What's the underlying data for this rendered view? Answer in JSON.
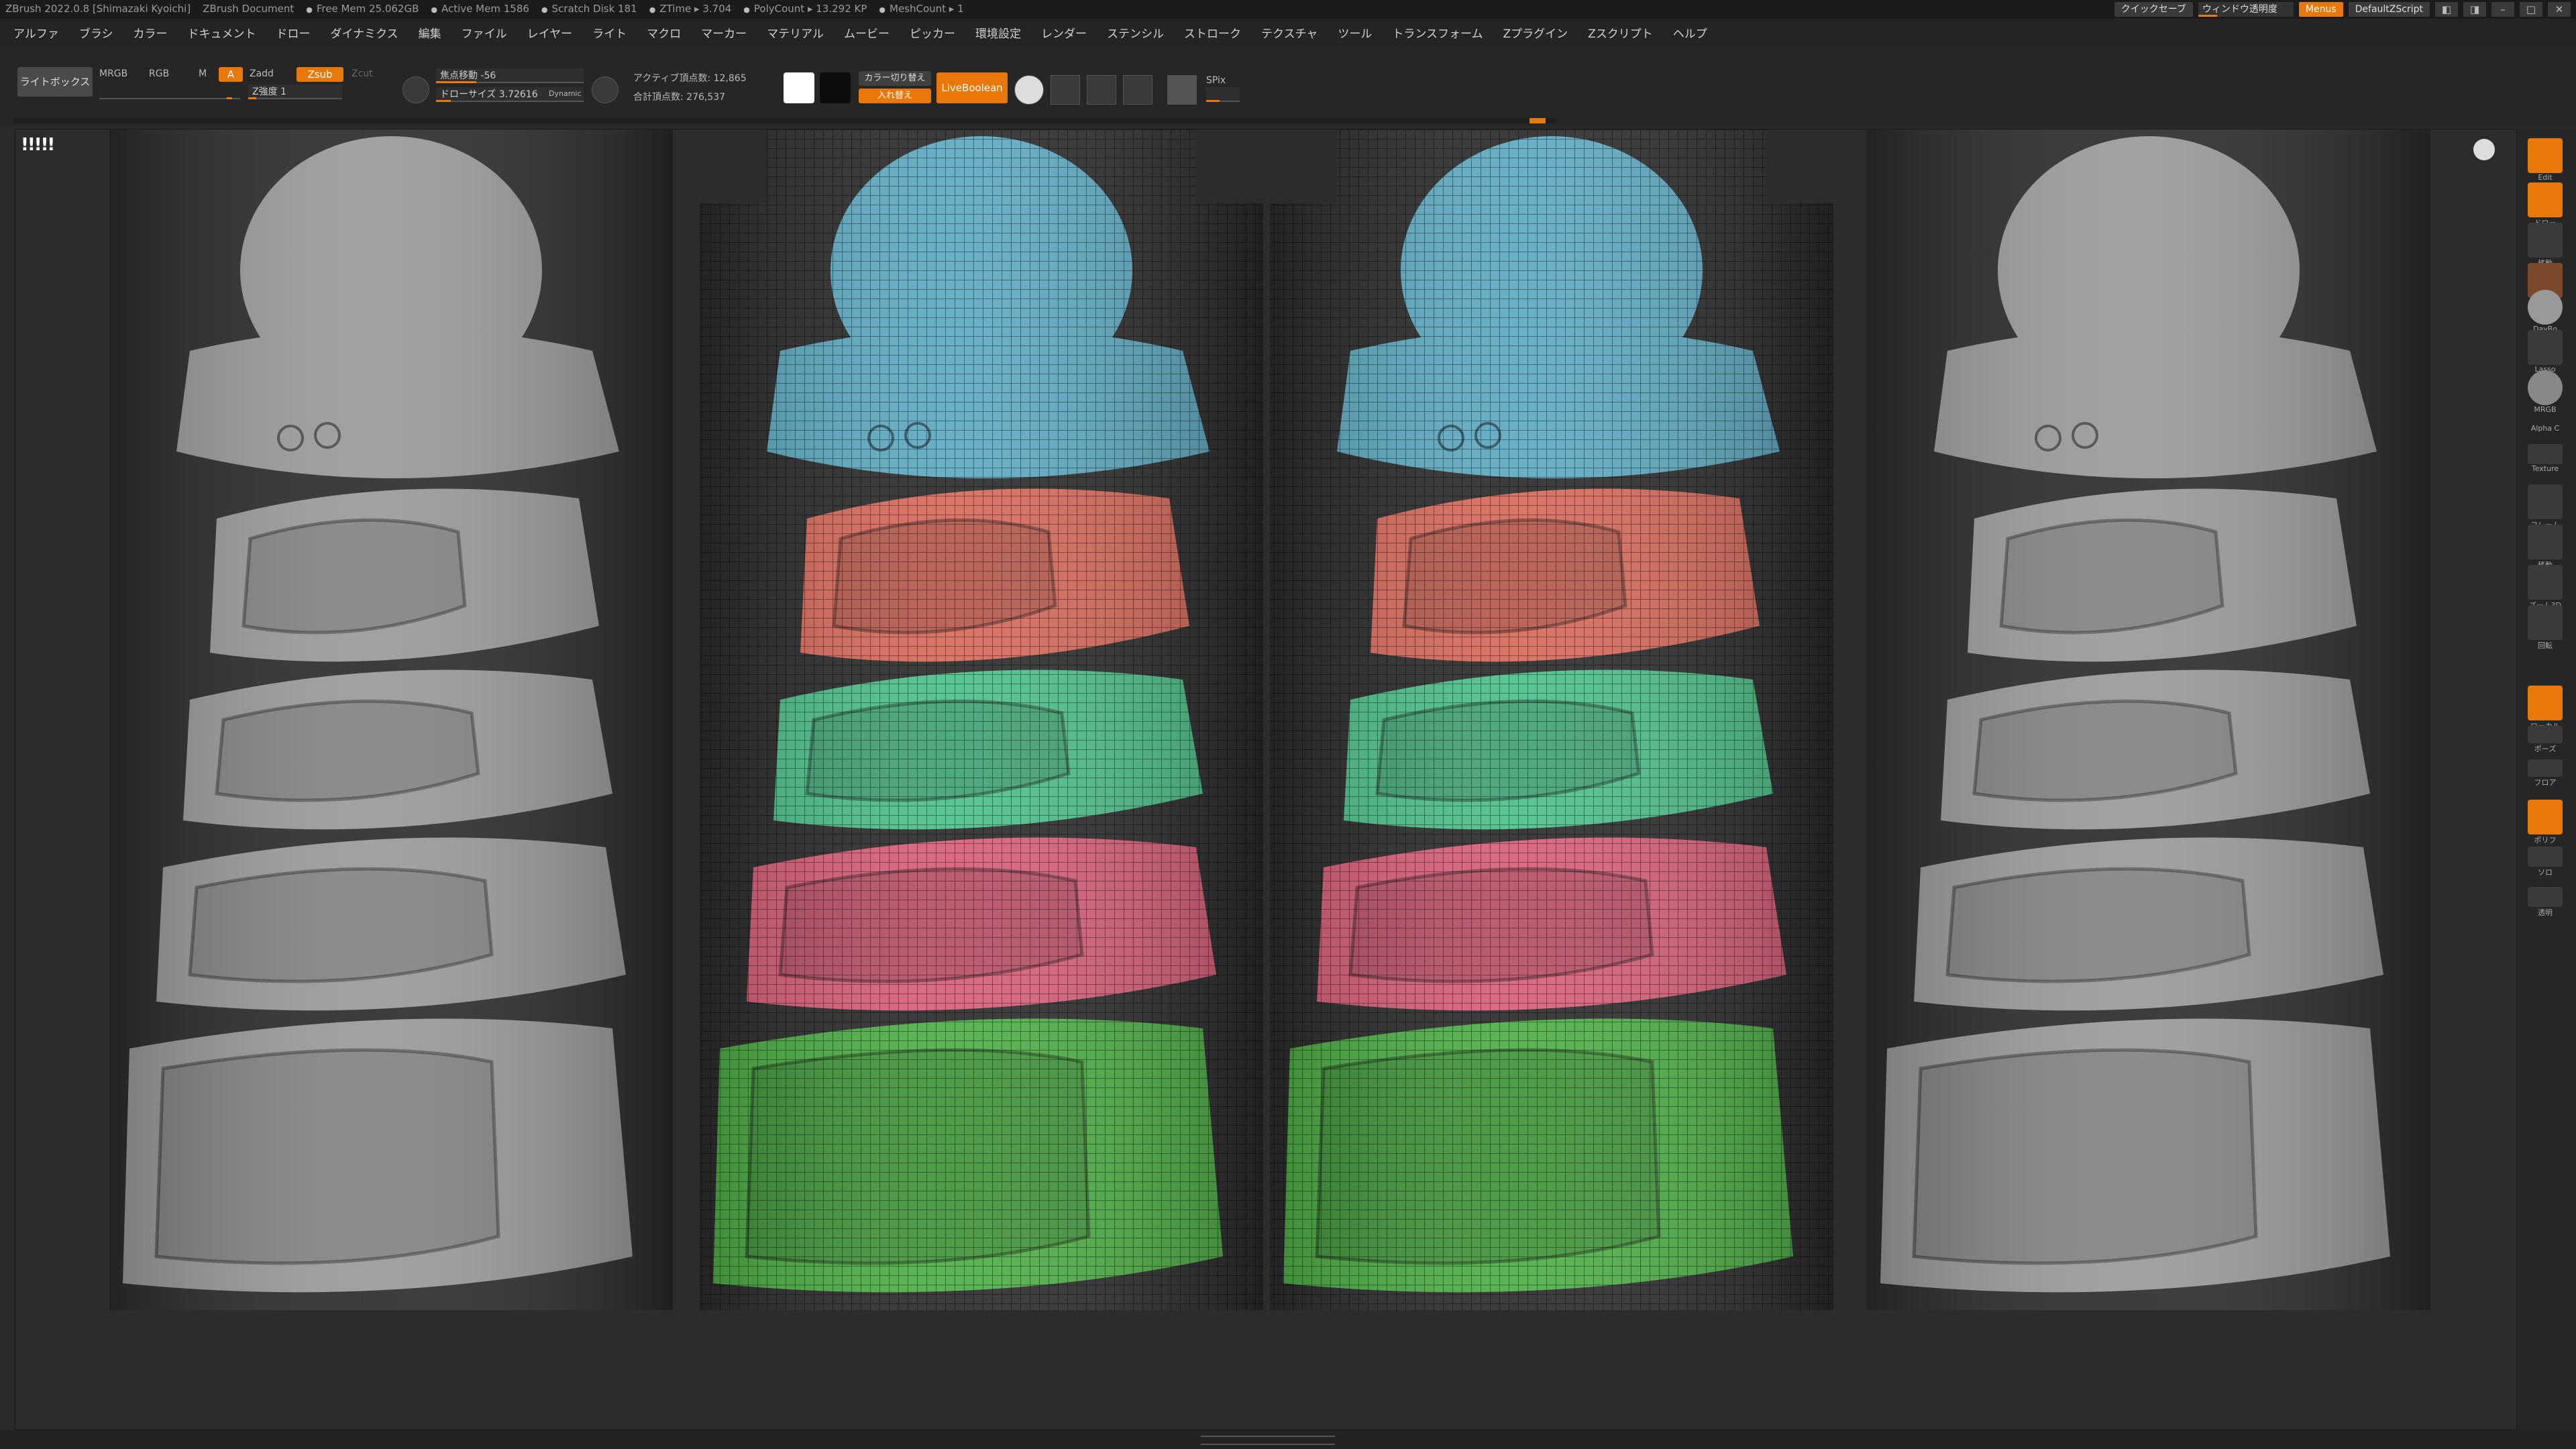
{
  "titlebar": {
    "app_title": "ZBrush 2022.0.8 [Shimazaki Kyoichi]",
    "document": "ZBrush Document",
    "free_mem": "Free Mem 25.062GB",
    "active_mem": "Active Mem 1586",
    "scratch_disk": "Scratch Disk 181",
    "ztime": "ZTime ▸ 3.704",
    "polycount": "PolyCount ▸ 13.292 KP",
    "meshcount": "MeshCount ▸ 1",
    "quicksave": "クイックセーブ",
    "window_transparency": "ウィンドウ透明度",
    "menus": "Menus",
    "default_script": "DefaultZScript"
  },
  "menu": [
    "アルファ",
    "ブラシ",
    "カラー",
    "ドキュメント",
    "ドロー",
    "ダイナミクス",
    "編集",
    "ファイル",
    "レイヤー",
    "ライト",
    "マクロ",
    "マーカー",
    "マテリアル",
    "ムービー",
    "ピッカー",
    "環境設定",
    "レンダー",
    "ステンシル",
    "ストローク",
    "テクスチャ",
    "ツール",
    "トランスフォーム",
    "Zプラグイン",
    "Zスクリプト",
    "ヘルプ"
  ],
  "shelf": {
    "lightbox": "ライトボックス",
    "mrgb": "MRGB",
    "rgb": "RGB",
    "m": "M",
    "a_btn": "A",
    "zadd": "Zadd",
    "zsub": "Zsub",
    "zcut": "Zcut",
    "zintensity": "Z強度 1",
    "focal_shift": "焦点移動 -56",
    "draw_size": "ドローサイズ 3.72616",
    "dynamic": "Dynamic",
    "active_points": "アクティブ頂点数: 12,865",
    "total_points": "合計頂点数: 276,537",
    "color_switch": "カラー切り替え",
    "swap": "入れ替え",
    "live_boolean": "LiveBoolean",
    "spix": "SPix"
  },
  "viewport": {
    "badge": "!!!!!",
    "colors": {
      "gray_clay": "#9a9a9a",
      "helmet_blue": "#5fa9c0",
      "visor_red": "#d56b5c",
      "band_teal": "#4fbf8a",
      "band_pink": "#d6607a",
      "band_green": "#4fae48",
      "accent": "#e8780a"
    }
  },
  "tray": {
    "edit": "Edit",
    "draw": "ドロー",
    "move": "移動",
    "dayglo": "DayBo",
    "lasso": "Lasso",
    "mrgb": "MRGB",
    "alpha": "Alpha C",
    "texture": "Texture",
    "frame": "フレーム",
    "move2": "移動",
    "zoom": "ズーム3D",
    "rotate": "回転",
    "local": "ローカル",
    "pose": "ポーズ",
    "floor": "フロア",
    "polyf": "ポリフ",
    "solo": "ソロ",
    "transp": "透明"
  }
}
